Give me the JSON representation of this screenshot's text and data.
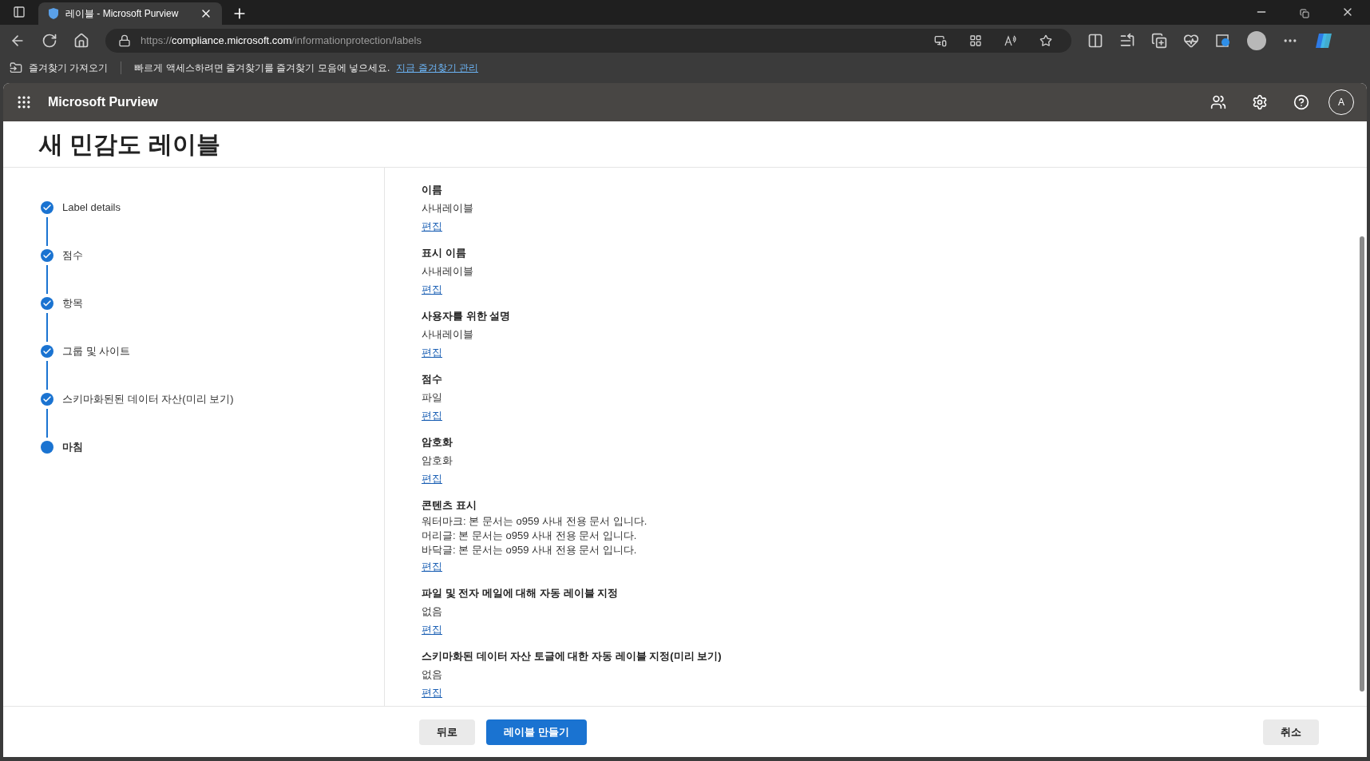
{
  "browser": {
    "tab_title": "레이블 - Microsoft Purview",
    "url_prefix": "https://",
    "url_host": "compliance.microsoft.com",
    "url_path": "/informationprotection/labels",
    "favorites_import": "즐겨찾기 가져오기",
    "favorites_hint": "빠르게 액세스하려면 즐겨찾기를 즐겨찾기 모음에 넣으세요.",
    "favorites_link": "지금 즐겨찾기 관리"
  },
  "app": {
    "title": "Microsoft Purview",
    "avatar": "A"
  },
  "page_title": "새 민감도 레이블",
  "steps": [
    {
      "label": "Label details",
      "completed": true,
      "selected": false
    },
    {
      "label": "점수",
      "completed": true,
      "selected": false
    },
    {
      "label": "항목",
      "completed": true,
      "selected": false
    },
    {
      "label": "그룹 및 사이트",
      "completed": true,
      "selected": false
    },
    {
      "label": "스키마화된된 데이터 자산(미리 보기)",
      "completed": true,
      "selected": false
    },
    {
      "label": "마침",
      "completed": false,
      "selected": true
    }
  ],
  "sections": [
    {
      "heading": "이름",
      "lines": [
        "사내레이블"
      ],
      "edit": "편집"
    },
    {
      "heading": "표시 이름",
      "lines": [
        "사내레이블"
      ],
      "edit": "편집"
    },
    {
      "heading": "사용자를 위한 설명",
      "lines": [
        "사내레이블"
      ],
      "edit": "편집"
    },
    {
      "heading": "점수",
      "lines": [
        "파일"
      ],
      "edit": "편집"
    },
    {
      "heading": "암호화",
      "lines": [
        "암호화"
      ],
      "edit": "편집"
    },
    {
      "heading": "콘텐츠 표시",
      "lines": [
        "워터마크: 본 문서는 o959 사내 전용 문서 입니다.",
        "머리글: 본 문서는 o959 사내 전용 문서 입니다.",
        "바닥글: 본 문서는 o959 사내 전용 문서 입니다."
      ],
      "edit": "편집"
    },
    {
      "heading": "파일 및 전자 메일에 대해 자동 레이블 지정",
      "lines": [
        "없음"
      ],
      "edit": "편집"
    },
    {
      "heading": "스키마화된 데이터 자산 토글에 대한 자동 레이블 지정(미리 보기)",
      "lines": [
        "없음"
      ],
      "edit": "편집"
    }
  ],
  "footer": {
    "back": "뒤로",
    "create": "레이블 만들기",
    "cancel": "취소"
  }
}
